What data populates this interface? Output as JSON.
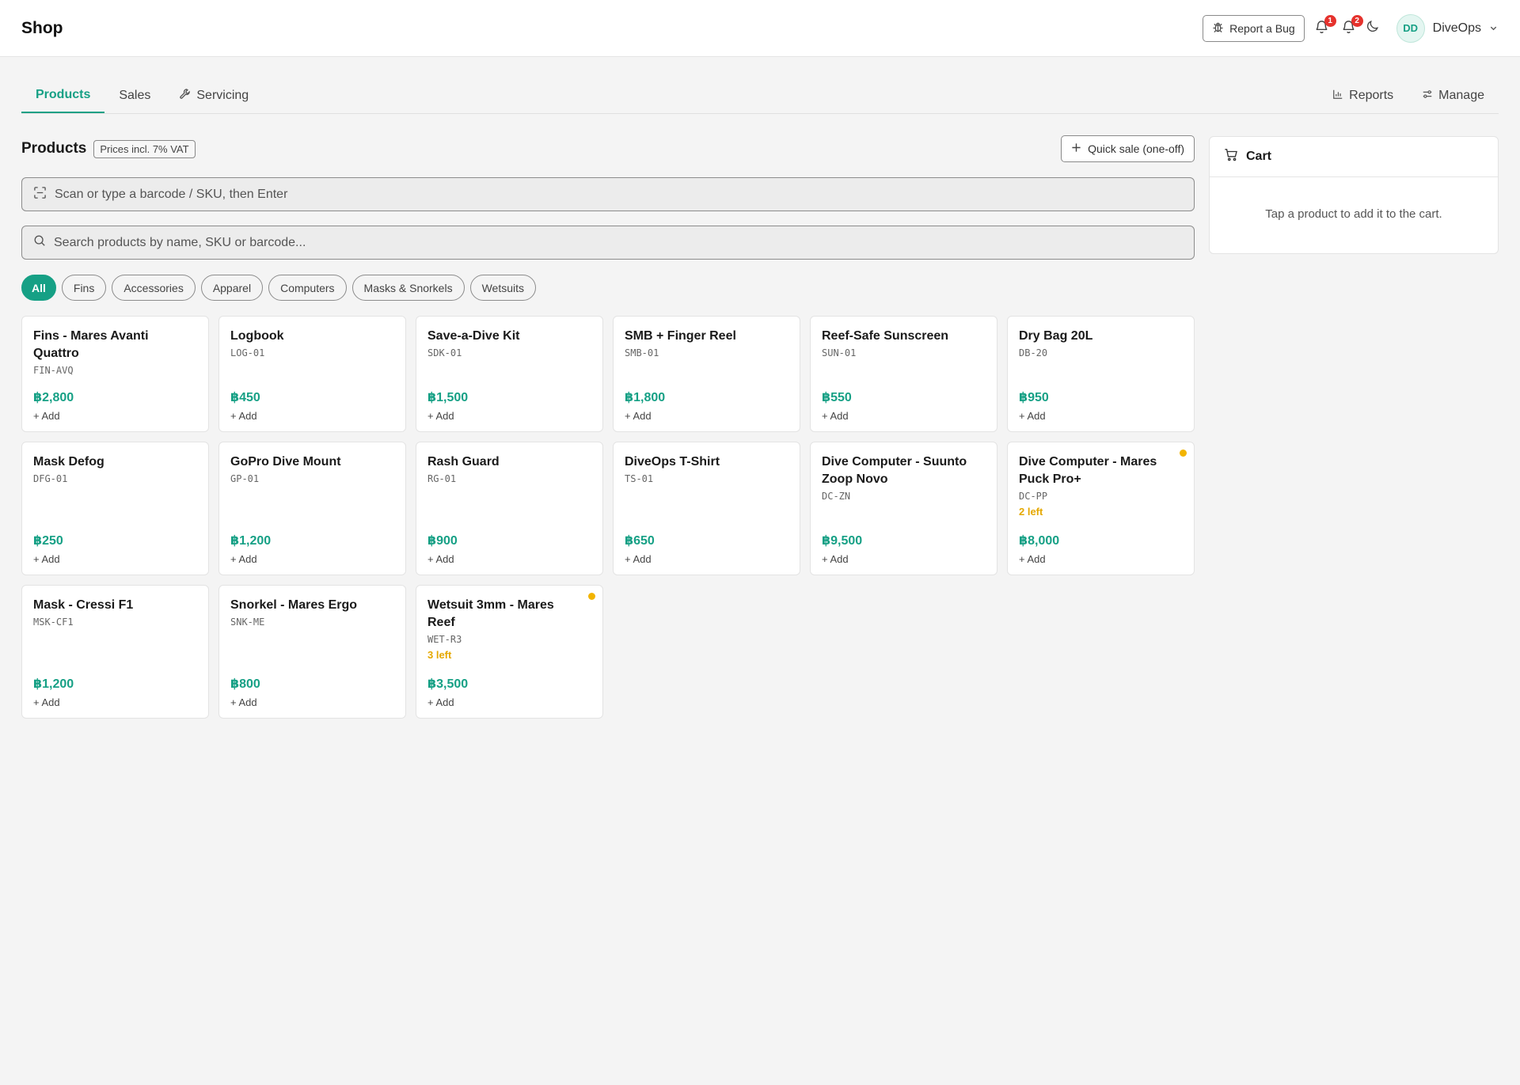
{
  "header": {
    "title": "Shop",
    "report_bug": "Report a Bug",
    "notifications": [
      {
        "count": "1",
        "icon": "bell-icon"
      },
      {
        "count": "2",
        "icon": "bell-icon"
      }
    ],
    "user": {
      "initials": "DD",
      "name": "DiveOps"
    }
  },
  "tabs": {
    "left": [
      "Products",
      "Sales",
      "Servicing"
    ],
    "right": [
      "Reports",
      "Manage"
    ]
  },
  "products": {
    "title": "Products",
    "vat_badge": "Prices incl. 7% VAT",
    "quick_sale": "Quick sale (one-off)",
    "scan_placeholder": "Scan or type a barcode / SKU, then Enter",
    "search_placeholder": "Search products by name, SKU or barcode...",
    "categories": [
      "All",
      "Fins",
      "Accessories",
      "Apparel",
      "Computers",
      "Masks & Snorkels",
      "Wetsuits"
    ],
    "add_label": "+ Add",
    "items": [
      {
        "name": "Fins - Mares Avanti Quattro",
        "sku": "FIN-AVQ",
        "price": "฿2,800",
        "stock": ""
      },
      {
        "name": "Logbook",
        "sku": "LOG-01",
        "price": "฿450",
        "stock": ""
      },
      {
        "name": "Save-a-Dive Kit",
        "sku": "SDK-01",
        "price": "฿1,500",
        "stock": ""
      },
      {
        "name": "SMB + Finger Reel",
        "sku": "SMB-01",
        "price": "฿1,800",
        "stock": ""
      },
      {
        "name": "Reef-Safe Sunscreen",
        "sku": "SUN-01",
        "price": "฿550",
        "stock": ""
      },
      {
        "name": "Dry Bag 20L",
        "sku": "DB-20",
        "price": "฿950",
        "stock": ""
      },
      {
        "name": "Mask Defog",
        "sku": "DFG-01",
        "price": "฿250",
        "stock": ""
      },
      {
        "name": "GoPro Dive Mount",
        "sku": "GP-01",
        "price": "฿1,200",
        "stock": ""
      },
      {
        "name": "Rash Guard",
        "sku": "RG-01",
        "price": "฿900",
        "stock": ""
      },
      {
        "name": "DiveOps T-Shirt",
        "sku": "TS-01",
        "price": "฿650",
        "stock": ""
      },
      {
        "name": "Dive Computer - Suunto Zoop Novo",
        "sku": "DC-ZN",
        "price": "฿9,500",
        "stock": ""
      },
      {
        "name": "Dive Computer - Mares Puck Pro+",
        "sku": "DC-PP",
        "price": "฿8,000",
        "stock": "2 left"
      },
      {
        "name": "Mask - Cressi F1",
        "sku": "MSK-CF1",
        "price": "฿1,200",
        "stock": ""
      },
      {
        "name": "Snorkel - Mares Ergo",
        "sku": "SNK-ME",
        "price": "฿800",
        "stock": ""
      },
      {
        "name": "Wetsuit 3mm - Mares Reef",
        "sku": "WET-R3",
        "price": "฿3,500",
        "stock": "3 left"
      }
    ]
  },
  "cart": {
    "title": "Cart",
    "empty_message": "Tap a product to add it to the cart."
  },
  "colors": {
    "accent": "#16a085",
    "warning": "#f2b400",
    "badge": "#e5322d"
  }
}
